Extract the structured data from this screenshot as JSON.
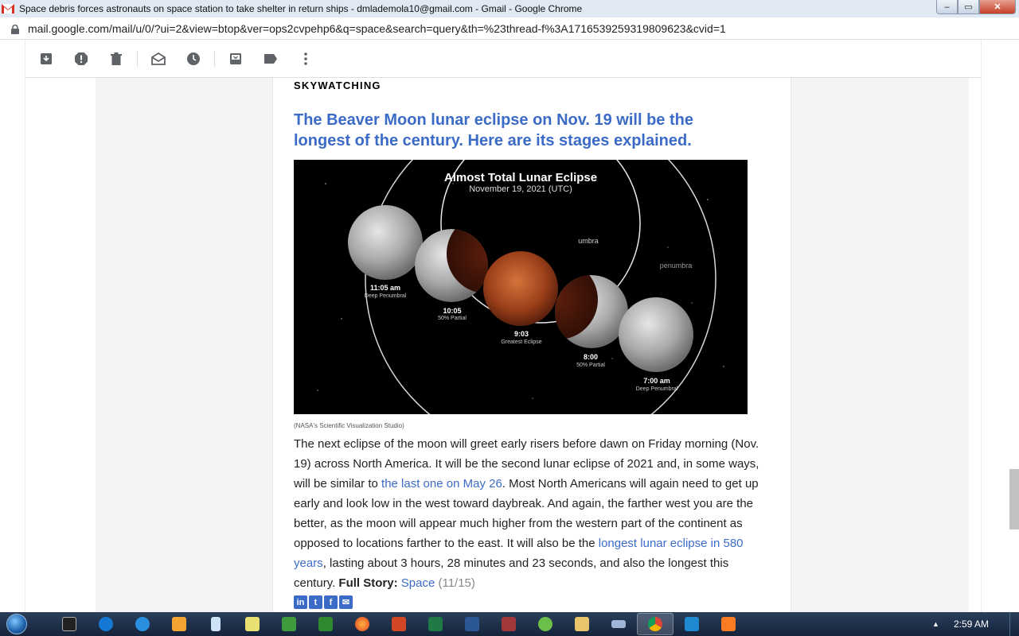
{
  "window": {
    "title": "Space debris forces astronauts on space station to take shelter in return ships - dmlademola10@gmail.com - Gmail - Google Chrome",
    "controls": [
      "minimize",
      "maximize",
      "close"
    ]
  },
  "address_bar": {
    "url": "mail.google.com/mail/u/0/?ui=2&view=btop&ver=ops2cvpehp6&q=space&search=query&th=%23thread-f%3A1716539259319809623&cvid=1"
  },
  "toolbar": {
    "icons": [
      "archive-icon",
      "report-spam-icon",
      "delete-icon",
      "mark-unread-icon",
      "snooze-icon",
      "move-to-icon",
      "label-icon",
      "more-icon"
    ]
  },
  "article": {
    "section": "SKYWATCHING",
    "headline": "The Beaver Moon lunar eclipse on Nov. 19 will be the longest of the century. Here are its stages explained.",
    "image": {
      "title": "Almost Total Lunar Eclipse",
      "subtitle": "November 19, 2021 (UTC)",
      "umbra_label": "umbra",
      "penumbra_label": "penumbra",
      "stages": [
        {
          "time": "11:05 am",
          "label": "Deep Penumbral"
        },
        {
          "time": "10:05",
          "label": "50% Partial"
        },
        {
          "time": "9:03",
          "label": "Greatest Eclipse"
        },
        {
          "time": "8:00",
          "label": "50% Partial"
        },
        {
          "time": "7:00 am",
          "label": "Deep Penumbral"
        }
      ]
    },
    "caption": "(NASA's Scientific Visualization Studio)",
    "body_1": "The next eclipse of the moon will greet early risers before dawn on Friday morning (Nov. 19) across North America. It will be the second lunar eclipse of 2021 and, in some ways, will be similar to ",
    "link_1": "the last one on May 26",
    "body_2": ". Most North Americans will again need to get up early and look low in the west toward daybreak. And again, the farther west you are the better, as the moon will appear much higher from the western part of the continent as opposed to locations farther to the east. It will also be the ",
    "link_2": "longest lunar eclipse in 580 years",
    "body_3": ", lasting about 3 hours, 28 minutes and 23 seconds, and also the longest this century. ",
    "full_story_label": "Full Story:",
    "story_link": "Space",
    "story_count": "(11/15)",
    "social": [
      "in",
      "t",
      "f",
      "✉"
    ]
  },
  "taskbar": {
    "apps": [
      "cmd",
      "teamviewer",
      "internet-explorer",
      "media-player",
      "notepad",
      "sticky-notes",
      "green-app",
      "firefox",
      "powerpoint",
      "excel",
      "word",
      "access",
      "xampp-green",
      "file-explorer",
      "keyboard",
      "chrome",
      "vscode",
      "xampp"
    ],
    "clock": "2:59 AM",
    "tray_arrow": "▲"
  },
  "colors": {
    "link": "#3c6bc7",
    "titlebar": "#dfe8f3",
    "taskbar": "#1c2d47"
  }
}
